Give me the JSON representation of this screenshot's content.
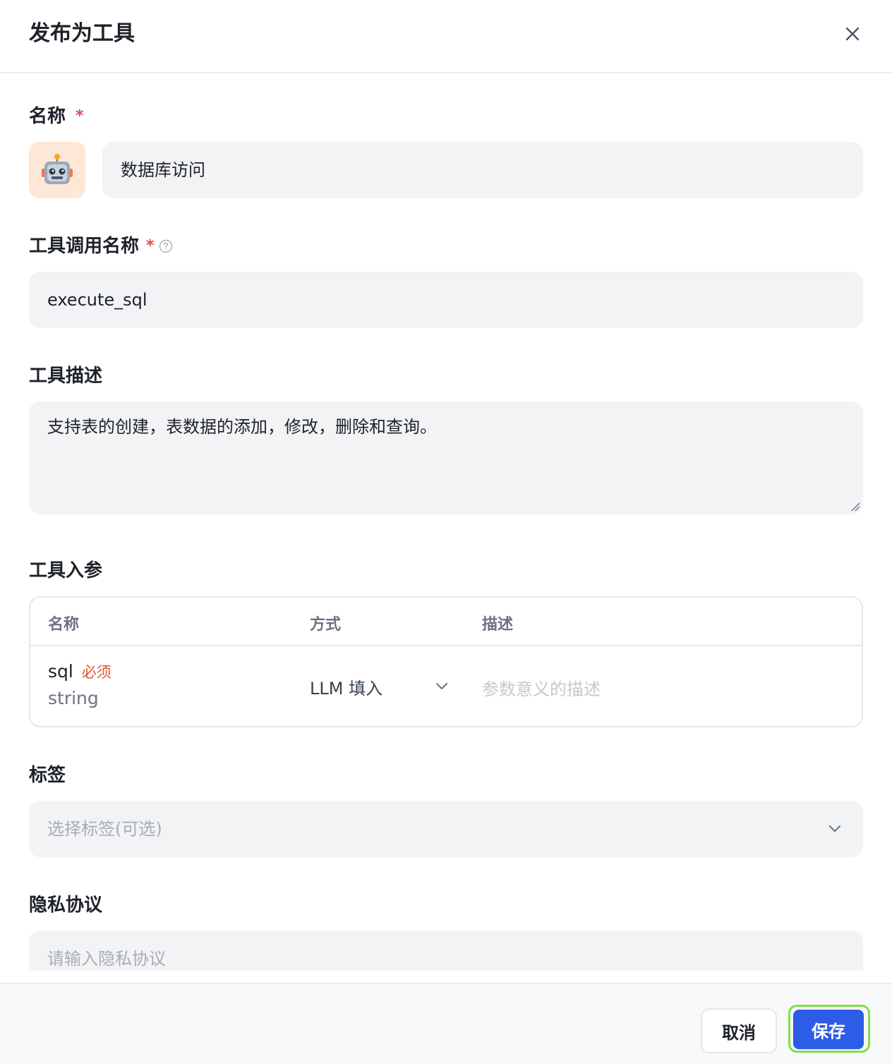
{
  "dialog": {
    "title": "发布为工具"
  },
  "form": {
    "name": {
      "label": "名称",
      "required_mark": "*",
      "avatar_icon": "robot-emoji-icon",
      "value": "数据库访问"
    },
    "call_name": {
      "label": "工具调用名称",
      "required_mark": "*",
      "help_icon": "question-circle-icon",
      "value": "execute_sql"
    },
    "description": {
      "label": "工具描述",
      "value": "支持表的创建，表数据的添加，修改，删除和查询。"
    },
    "params": {
      "label": "工具入参",
      "columns": [
        "名称",
        "方式",
        "描述"
      ],
      "rows": [
        {
          "name": "sql",
          "required_badge": "必须",
          "type": "string",
          "method": "LLM 填入",
          "description_placeholder": "参数意义的描述"
        }
      ]
    },
    "tags": {
      "label": "标签",
      "placeholder": "选择标签(可选)"
    },
    "privacy": {
      "label": "隐私协议",
      "placeholder": "请输入隐私协议"
    }
  },
  "footer": {
    "cancel_label": "取消",
    "save_label": "保存"
  },
  "colors": {
    "primary": "#2d5ce6",
    "required": "#e5484d",
    "badge": "#e0552a",
    "focus_ring": "#7ee04a",
    "field_bg": "#f2f3f5"
  }
}
